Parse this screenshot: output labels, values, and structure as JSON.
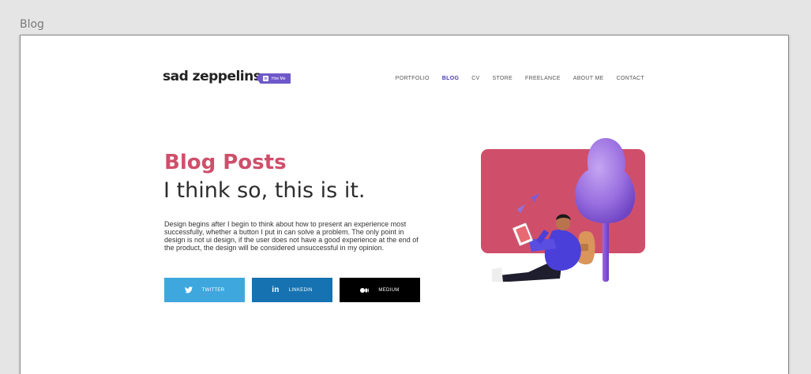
{
  "frame_label": "Blog",
  "logo": "sad zeppelins",
  "hire_button": {
    "icon": "in",
    "label": "Hire Me"
  },
  "nav": {
    "items": [
      {
        "label": "PORTFOLIO"
      },
      {
        "label": "BLOG"
      },
      {
        "label": "CV"
      },
      {
        "label": "STORE"
      },
      {
        "label": "FREELANCE"
      },
      {
        "label": "ABOUT ME"
      },
      {
        "label": "CONTACT"
      }
    ],
    "active": "BLOG"
  },
  "hero": {
    "title": "Blog Posts",
    "subtitle": "I think so, this is it.",
    "description": "Design begins after I begin to think about how to present an experience most successfully, whether a button I put in can solve a problem. The only point in design is not ui design, if the user does not have a good experience at the end of the product, the design will be considered unsuccessful in my opinion."
  },
  "social_buttons": {
    "twitter": {
      "label": "TWITTER",
      "color": "#3ea8de",
      "icon": "twitter-icon"
    },
    "linkedin": {
      "label": "LINKEDIN",
      "color": "#1672b0",
      "icon": "linkedin-icon",
      "icon_text": "in"
    },
    "medium": {
      "label": "MEDIUM",
      "color": "#000000",
      "icon": "medium-icon"
    }
  },
  "colors": {
    "accent": "#cf4f6b",
    "nav_active": "#4a3cb0",
    "hire_badge": "#6f58c9",
    "tree": "#9a6fe0"
  }
}
